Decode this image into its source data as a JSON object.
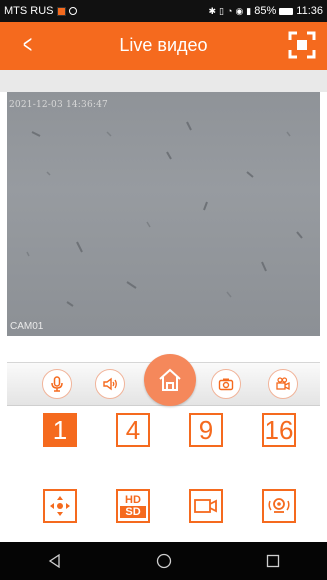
{
  "status_bar": {
    "carrier": "MTS RUS",
    "battery": "85%",
    "time": "11:36",
    "icons": [
      "bluetooth-icon",
      "vibrate-icon",
      "alarm-icon",
      "eye-comfort-icon",
      "signal-icon",
      "battery-icon"
    ]
  },
  "header": {
    "title": "Live видео",
    "back_icon": "chevron-left-icon",
    "fullscreen_icon": "fullscreen-icon"
  },
  "video": {
    "timestamp": "2021-12-03 14:36:47",
    "camera_label": "CAM01"
  },
  "controls": {
    "items": [
      "microphone-icon",
      "speaker-icon",
      "home-icon",
      "camera-snapshot-icon",
      "video-record-icon"
    ]
  },
  "layout_options": {
    "items": [
      "1",
      "4",
      "9",
      "16"
    ],
    "selected": "1"
  },
  "tools": {
    "ptz_icon": "ptz-direction-icon",
    "quality_hd": "HD",
    "quality_sd": "SD",
    "record_icon": "video-camera-icon",
    "cruise_icon": "cruise-icon"
  },
  "colors": {
    "accent": "#f56a1e",
    "accent_light": "#f5885b",
    "status_bar": "#111111",
    "nav_bar": "#050505",
    "video_bg": "#93979c"
  },
  "nav": {
    "items": [
      "back-triangle-icon",
      "home-circle-icon",
      "recents-square-icon"
    ]
  }
}
